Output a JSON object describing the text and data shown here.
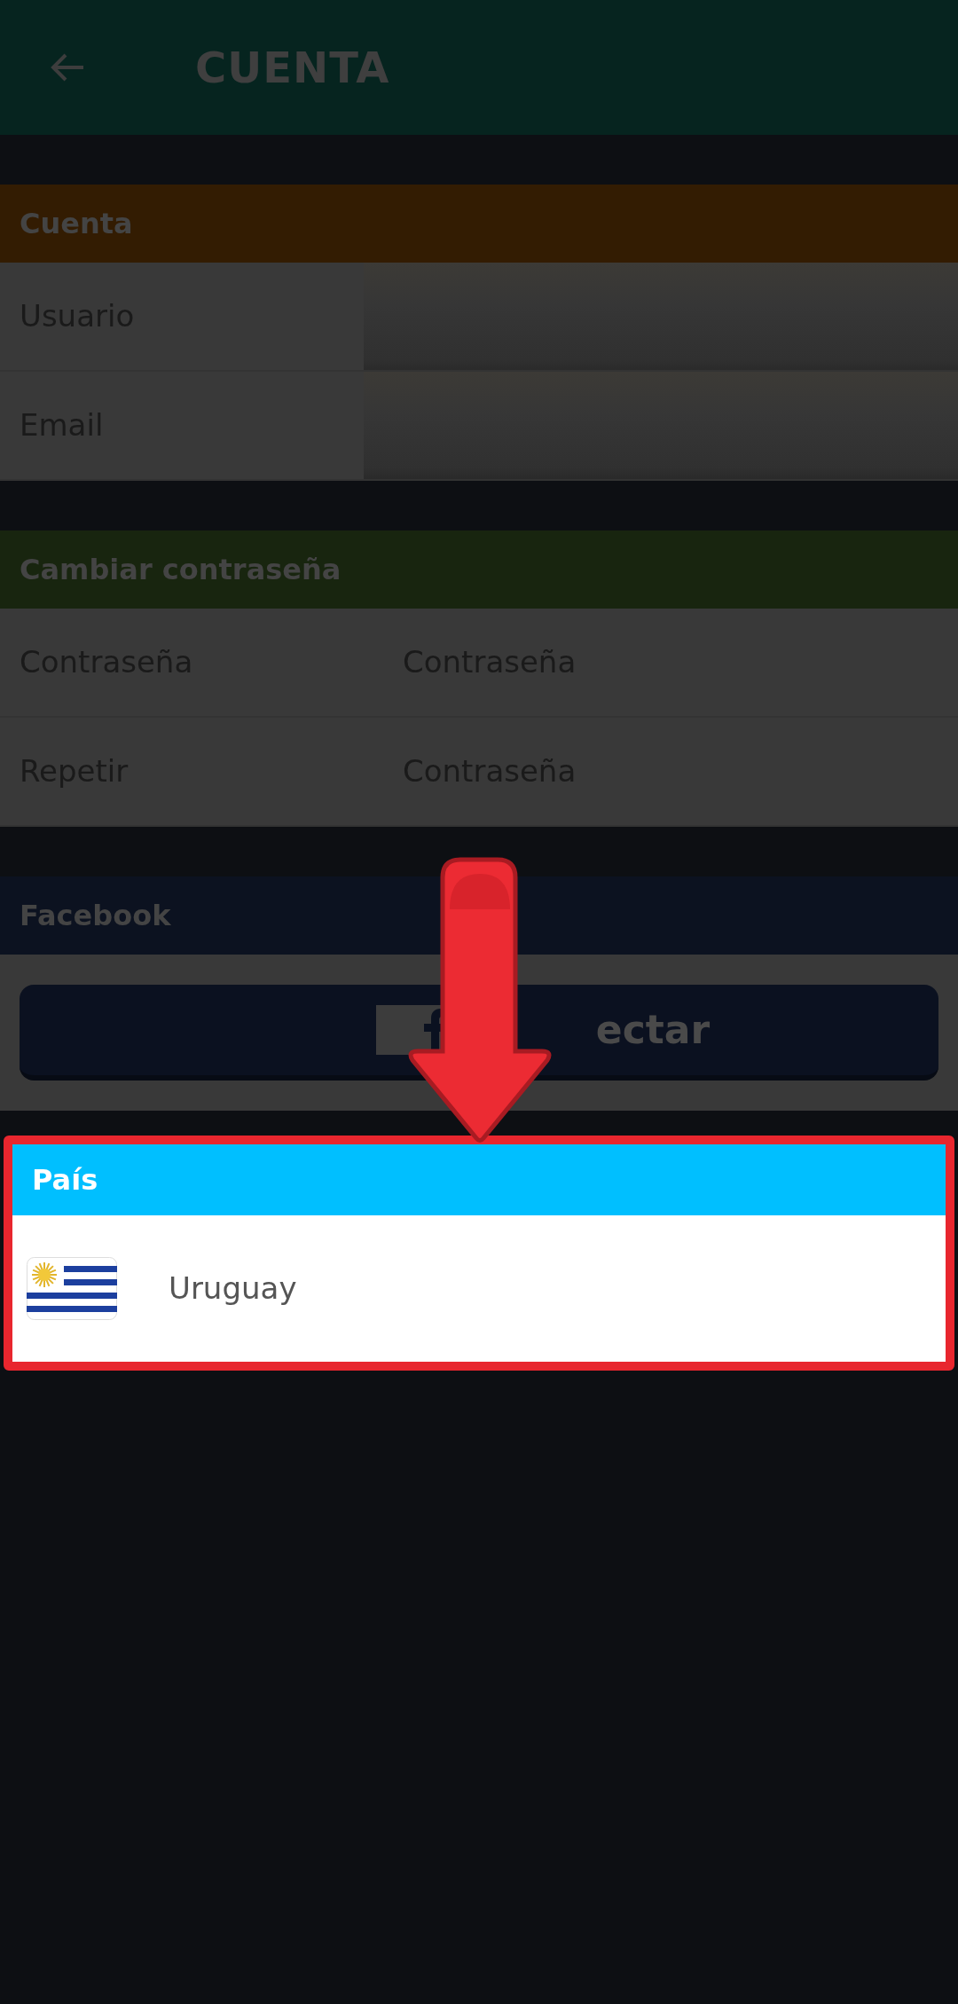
{
  "app_bar": {
    "title": "CUENTA"
  },
  "sections": [
    {
      "kind": "fields",
      "title": "Cuenta",
      "color": "#331c02",
      "rows": [
        {
          "label": "Usuario",
          "kind": "blurred"
        },
        {
          "label": "Email",
          "kind": "blurred"
        }
      ]
    },
    {
      "kind": "fields",
      "title": "Cambiar contraseña",
      "color": "#18250f",
      "rows": [
        {
          "label": "Contraseña",
          "kind": "input",
          "placeholder": "Contraseña"
        },
        {
          "label": "Repetir",
          "kind": "input",
          "placeholder": "Contraseña"
        }
      ]
    },
    {
      "kind": "button",
      "title": "Facebook",
      "color": "#0c1220",
      "button": "ectar"
    },
    {
      "kind": "country",
      "title": "País",
      "color": "#00bfff",
      "highlighted": true,
      "country": "Uruguay"
    }
  ]
}
